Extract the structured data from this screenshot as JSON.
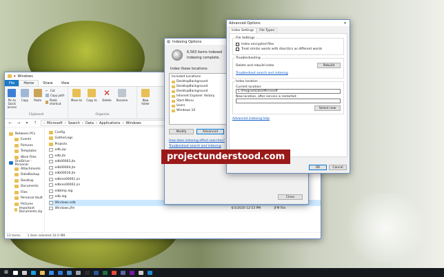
{
  "explorer": {
    "title": "Windows",
    "tabs": [
      "File",
      "Home",
      "Share",
      "View"
    ],
    "ribbon": {
      "clipboard": {
        "pin_label": "Pin to Quick access",
        "copy_label": "Copy",
        "paste_label": "Paste",
        "cut_label": "Cut",
        "copy_path_label": "Copy path",
        "paste_shortcut_label": "Paste shortcut",
        "group_label": "Clipboard"
      },
      "organize": {
        "move_to_label": "Move to",
        "copy_to_label": "Copy to",
        "delete_label": "Delete",
        "rename_label": "Rename",
        "group_label": "Organize"
      },
      "new": {
        "new_folder_label": "New folder"
      }
    },
    "address_path": [
      "Microsoft",
      "Search",
      "Data",
      "Applications",
      "Windows"
    ],
    "nav_items": [
      {
        "label": "Between PCs",
        "level": "top",
        "color": "#e8bf55"
      },
      {
        "label": "Events",
        "level": "sub",
        "color": "#e8bf55"
      },
      {
        "label": "Pictures",
        "level": "sub",
        "color": "#e8bf55"
      },
      {
        "label": "Templates",
        "level": "sub",
        "color": "#e8bf55"
      },
      {
        "label": "Work Files",
        "level": "sub",
        "color": "#e8bf55"
      },
      {
        "label": "OneDrive - Personal",
        "level": "top",
        "color": "#1f74c5"
      },
      {
        "label": "Attachments",
        "level": "sub",
        "color": "#e8bf55"
      },
      {
        "label": "DataBackup",
        "level": "sub",
        "color": "#e8bf55"
      },
      {
        "label": "Desktop",
        "level": "sub",
        "color": "#e8bf55"
      },
      {
        "label": "Documents",
        "level": "sub",
        "color": "#e8bf55"
      },
      {
        "label": "Files",
        "level": "sub",
        "color": "#e8bf55"
      },
      {
        "label": "Personal Vault",
        "level": "sub",
        "color": "#e8bf55"
      },
      {
        "label": "Pictures",
        "level": "sub",
        "color": "#e8bf55"
      },
      {
        "label": "Important Documents.zip",
        "level": "sub",
        "color": "#e8bf55"
      }
    ],
    "files": [
      {
        "name": "Config",
        "date": "",
        "type": "",
        "size": "",
        "icon": "folder",
        "selected": false
      },
      {
        "name": "GatherLogs",
        "date": "",
        "type": "",
        "size": "",
        "icon": "folder",
        "selected": false
      },
      {
        "name": "Projects",
        "date": "",
        "type": "",
        "size": "",
        "icon": "folder",
        "selected": false
      },
      {
        "name": "edb.jcp",
        "date": "",
        "type": "",
        "size": "",
        "icon": "file",
        "selected": false
      },
      {
        "name": "edb.jtx",
        "date": "",
        "type": "",
        "size": "",
        "icon": "file",
        "selected": false
      },
      {
        "name": "edb00003.jtx",
        "date": "",
        "type": "",
        "size": "",
        "icon": "file",
        "selected": false
      },
      {
        "name": "edb00004.jtx",
        "date": "",
        "type": "",
        "size": "",
        "icon": "file",
        "selected": false
      },
      {
        "name": "edb00016.jtx",
        "date": "",
        "type": "",
        "size": "",
        "icon": "file",
        "selected": false
      },
      {
        "name": "edbres00001.jrs",
        "date": "",
        "type": "",
        "size": "",
        "icon": "file",
        "selected": false
      },
      {
        "name": "edbres00002.jrs",
        "date": "",
        "type": "",
        "size": "",
        "icon": "file",
        "selected": false
      },
      {
        "name": "edbtmp.log",
        "date": "5/29/2020 9:31 AM",
        "type": "JRS File",
        "size": "1,024 KB",
        "icon": "file",
        "selected": false
      },
      {
        "name": "edb.log",
        "date": "5/29/2020 9:31 AM",
        "type": "JTX File",
        "size": "1,024 KB",
        "icon": "file",
        "selected": false
      },
      {
        "name": "Windows.edb",
        "date": "6/1/2020 12:53 PM",
        "type": "EDB File",
        "size": "32,768 KB",
        "icon": "file",
        "selected": true
      },
      {
        "name": "Windows.jfm",
        "date": "6/1/2020 12:53 PM",
        "type": "JFM File",
        "size": "16 KB",
        "icon": "file",
        "selected": false
      }
    ],
    "status": {
      "items": "13 items",
      "selected": "1 item selected  32.0 MB"
    }
  },
  "indexing": {
    "title": "Indexing Options",
    "items_indexed": "6,563 items indexed",
    "status": "Indexing complete.",
    "index_these": "Index these locations:",
    "included_header": "Included Locations",
    "locations": [
      "DesktopBackground",
      "DesktopBackground",
      "DesktopBackground",
      "Internet Explorer History",
      "Start Menu",
      "Users",
      "Windows 10"
    ],
    "modify_label": "Modify",
    "advanced_label": "Advanced",
    "pause_label": "Pause",
    "link_how": "How does indexing affect searches?",
    "link_troubleshoot": "Troubleshoot search and indexing",
    "close_label": "Close"
  },
  "advanced": {
    "title": "Advanced Options",
    "tabs": [
      "Index Settings",
      "File Types"
    ],
    "file_settings": "File Settings",
    "check_encrypted": "Index encrypted files",
    "check_diacritics": "Treat similar words with diacritics as different words",
    "troubleshooting": "Troubleshooting",
    "delete_rebuild": "Delete and rebuild index",
    "rebuild_label": "Rebuild",
    "troubleshoot_link": "Troubleshoot search and indexing",
    "index_location": "Index location",
    "current_location": "Current location:",
    "current_path": "C:\\ProgramData\\Microsoft",
    "new_location": "New location, after service is restarted:",
    "select_new_label": "Select new",
    "adv_help": "Advanced indexing help",
    "ok_label": "OK",
    "cancel_label": "Cancel"
  },
  "watermark": "projectunderstood.com",
  "taskbar_icons": [
    {
      "name": "start-icon",
      "color": "#ffffff"
    },
    {
      "name": "search-icon",
      "color": "#ffffff"
    },
    {
      "name": "task-view-icon",
      "color": "#cfcfcf"
    },
    {
      "name": "edge-icon",
      "color": "#1aa0e0"
    },
    {
      "name": "file-explorer-icon",
      "color": "#e8bf55"
    },
    {
      "name": "store-icon",
      "color": "#3a8ee6"
    },
    {
      "name": "mail-icon",
      "color": "#2b7bd6"
    },
    {
      "name": "photos-icon",
      "color": "#4a8fd4"
    },
    {
      "name": "settings-icon",
      "color": "#9aa3ad"
    },
    {
      "name": "terminal-icon",
      "color": "#2e2e2e"
    },
    {
      "name": "word-icon",
      "color": "#2b579a"
    },
    {
      "name": "excel-icon",
      "color": "#1e7145"
    },
    {
      "name": "maps-icon",
      "color": "#e74c3c"
    },
    {
      "name": "teams-icon",
      "color": "#6264a7"
    },
    {
      "name": "onenote-icon",
      "color": "#7719aa"
    },
    {
      "name": "indexing-icon",
      "color": "#cccccc"
    },
    {
      "name": "vscode-icon",
      "color": "#1f8ad2"
    }
  ]
}
